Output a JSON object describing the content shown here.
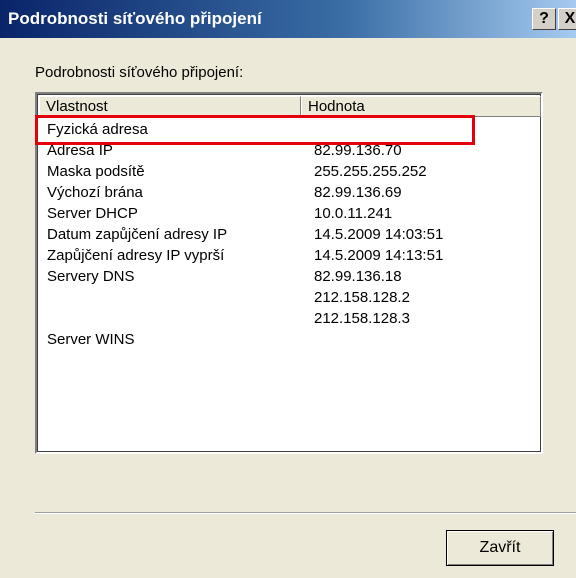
{
  "window": {
    "title": "Podrobnosti síťového připojení",
    "help_label": "?",
    "close_label": "X"
  },
  "group_label": "Podrobnosti síťového připojení:",
  "columns": {
    "property": "Vlastnost",
    "value": "Hodnota"
  },
  "rows": [
    {
      "property": "Fyzická adresa",
      "value": ""
    },
    {
      "property": "Adresa IP",
      "value": "82.99.136.70"
    },
    {
      "property": "Maska podsítě",
      "value": "255.255.255.252"
    },
    {
      "property": "Výchozí brána",
      "value": "82.99.136.69"
    },
    {
      "property": "Server DHCP",
      "value": "10.0.11.241"
    },
    {
      "property": "Datum zapůjčení adresy IP",
      "value": "14.5.2009 14:03:51"
    },
    {
      "property": "Zapůjčení adresy IP vyprší",
      "value": "14.5.2009 14:13:51"
    },
    {
      "property": "Servery DNS",
      "value": "82.99.136.18"
    },
    {
      "property": "",
      "value": "212.158.128.2"
    },
    {
      "property": "",
      "value": "212.158.128.3"
    },
    {
      "property": "Server WINS",
      "value": ""
    }
  ],
  "buttons": {
    "close": "Zavřít"
  },
  "colors": {
    "highlight": "#e3000b",
    "titlebar": "#0a246a"
  }
}
